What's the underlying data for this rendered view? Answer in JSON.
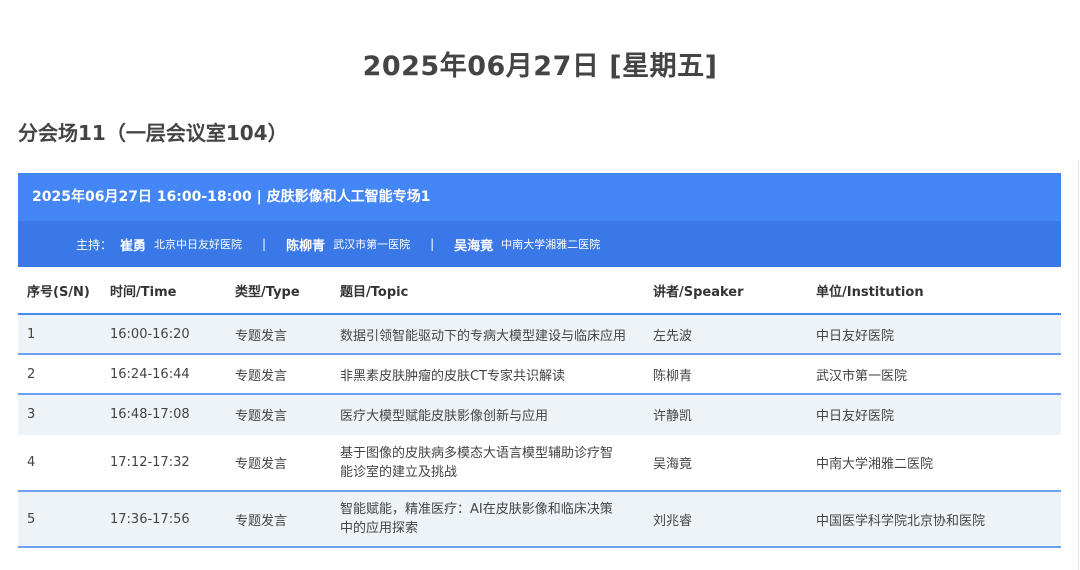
{
  "header": {
    "date_title": "2025年06月27日 [星期五]",
    "venue_title": "分会场11（一层会议室104）"
  },
  "session": {
    "title": "2025年06月27日 16:00-18:00 | 皮肤影像和人工智能专场1",
    "host_label": "主持：",
    "hosts": [
      {
        "name": "崔勇",
        "institution": "北京中日友好医院"
      },
      {
        "name": "陈柳青",
        "institution": "武汉市第一医院"
      },
      {
        "name": "吴海竟",
        "institution": "中南大学湘雅二医院"
      }
    ],
    "separator": "|"
  },
  "table": {
    "columns": [
      "序号(S/N)",
      "时间/Time",
      "类型/Type",
      "题目/Topic",
      "讲者/Speaker",
      "单位/Institution"
    ],
    "rows": [
      {
        "sn": "1",
        "time": "16:00-16:20",
        "type": "专题发言",
        "topic": "数据引领智能驱动下的专病大模型建设与临床应用",
        "speaker": "左先波",
        "institution": "中日友好医院"
      },
      {
        "sn": "2",
        "time": "16:24-16:44",
        "type": "专题发言",
        "topic": "非黑素皮肤肿瘤的皮肤CT专家共识解读",
        "speaker": "陈柳青",
        "institution": "武汉市第一医院"
      },
      {
        "sn": "3",
        "time": "16:48-17:08",
        "type": "专题发言",
        "topic": "医疗大模型赋能皮肤影像创新与应用",
        "speaker": "许静凯",
        "institution": "中日友好医院"
      },
      {
        "sn": "4",
        "time": "17:12-17:32",
        "type": "专题发言",
        "topic": "基于图像的皮肤病多模态大语言模型辅助诊疗智能诊室的建立及挑战",
        "speaker": "吴海竟",
        "institution": "中南大学湘雅二医院"
      },
      {
        "sn": "5",
        "time": "17:36-17:56",
        "type": "专题发言",
        "topic": "智能赋能，精准医疗：AI在皮肤影像和临床决策中的应用探索",
        "speaker": "刘兆睿",
        "institution": "中国医学科学院北京协和医院"
      }
    ]
  },
  "colors": {
    "session_header": "#4486f6",
    "hosts_bar": "#3a78e8",
    "row_alt": "#eef3f7",
    "divider": "#6da0f2"
  }
}
